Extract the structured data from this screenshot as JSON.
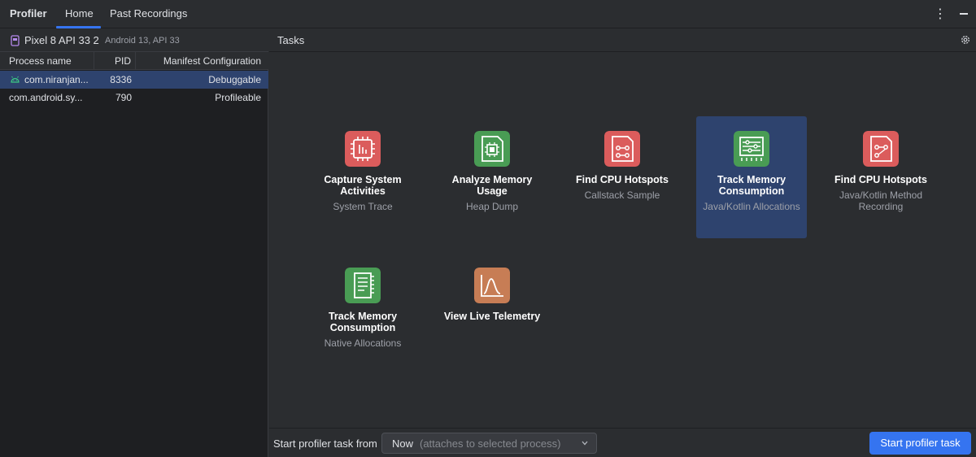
{
  "topbar": {
    "title": "Profiler",
    "tabs": [
      {
        "label": "Home",
        "active": true
      },
      {
        "label": "Past Recordings",
        "active": false
      }
    ],
    "more_glyph": "⋮"
  },
  "device": {
    "name": "Pixel 8 API 33 2",
    "subtitle": "Android 13, API 33"
  },
  "process_table": {
    "headers": {
      "name": "Process name",
      "pid": "PID",
      "manifest": "Manifest Configuration"
    },
    "rows": [
      {
        "name": "com.niranjan...",
        "pid": "8336",
        "manifest": "Debuggable",
        "selected": true,
        "icon": "android-icon"
      },
      {
        "name": "com.android.sy...",
        "pid": "790",
        "manifest": "Profileable",
        "selected": false
      }
    ]
  },
  "tasks_panel": {
    "label": "Tasks",
    "tasks": [
      {
        "title": "Capture System Activities",
        "subtitle": "System Trace",
        "icon": "system-trace-icon",
        "color": "#db5c5c"
      },
      {
        "title": "Analyze Memory Usage",
        "subtitle": "Heap Dump",
        "icon": "heap-dump-icon",
        "color": "#499c54"
      },
      {
        "title": "Find CPU Hotspots",
        "subtitle": "Callstack Sample",
        "icon": "callstack-icon",
        "color": "#db5c5c"
      },
      {
        "title": "Track Memory Consumption",
        "subtitle": "Java/Kotlin Allocations",
        "icon": "java-allocations-icon",
        "color": "#499c54",
        "selected": true
      },
      {
        "title": "Find CPU Hotspots",
        "subtitle": "Java/Kotlin Method Recording",
        "icon": "method-recording-icon",
        "color": "#db5c5c"
      },
      {
        "title": "Track Memory Consumption",
        "subtitle": "Native Allocations",
        "icon": "native-allocations-icon",
        "color": "#499c54"
      },
      {
        "title": "View Live Telemetry",
        "subtitle": "",
        "icon": "telemetry-icon",
        "color": "#c77d55"
      }
    ]
  },
  "bottom_bar": {
    "start_label": "Start profiler task from",
    "select_value": "Now",
    "select_hint": "(attaches to selected process)",
    "button_label": "Start profiler task"
  },
  "colors": {
    "accent": "#3574f0",
    "selection": "#2e436e",
    "red_icon": "#db5c5c",
    "green_icon": "#499c54",
    "orange_icon": "#c77d55"
  }
}
